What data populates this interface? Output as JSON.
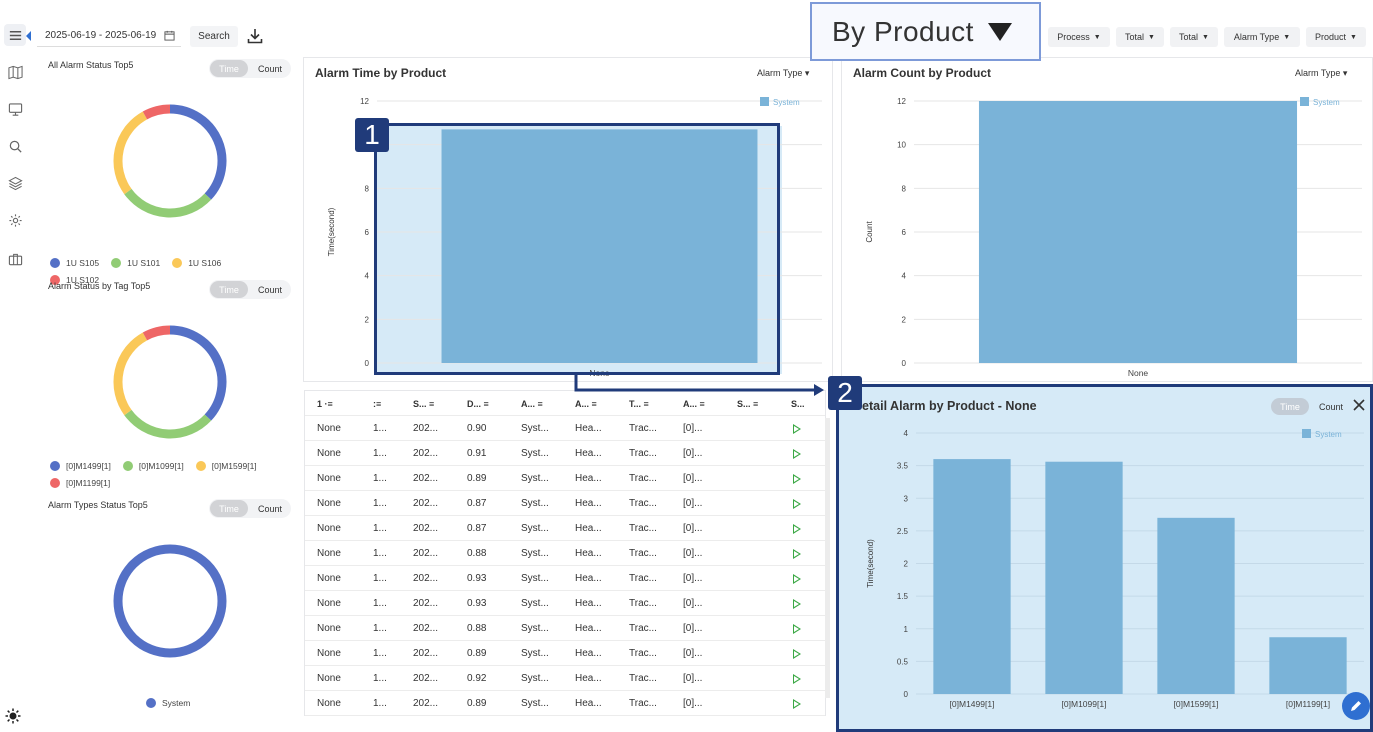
{
  "toolbar": {
    "date_range": "2025-06-19 - 2025-06-19",
    "search_label": "Search",
    "view_selector": "By Product",
    "filters": [
      "Process",
      "Total",
      "Total",
      "Alarm Type",
      "Product"
    ]
  },
  "rail": {
    "icons": [
      "menu-icon",
      "map-icon",
      "monitor-icon",
      "search-icon",
      "layers-icon",
      "gear-icon",
      "briefcase-icon"
    ],
    "theme_icon": "sun-icon"
  },
  "side": {
    "toggle_time": "Time",
    "toggle_count": "Count",
    "panels": [
      {
        "title": "All Alarm Status Top5",
        "slices": [
          {
            "label": "1U S105",
            "value": 37,
            "color": "#5470c6"
          },
          {
            "label": "1U S101",
            "value": 28,
            "color": "#91cc75"
          },
          {
            "label": "1U S106",
            "value": 27,
            "color": "#fac858"
          },
          {
            "label": "1U S102",
            "value": 8,
            "color": "#ee6666"
          }
        ]
      },
      {
        "title": "Alarm Status by Tag Top5",
        "slices": [
          {
            "label": "[0]M1499[1]",
            "value": 37,
            "color": "#5470c6"
          },
          {
            "label": "[0]M1099[1]",
            "value": 28,
            "color": "#91cc75"
          },
          {
            "label": "[0]M1599[1]",
            "value": 27,
            "color": "#fac858"
          },
          {
            "label": "[0]M1199[1]",
            "value": 8,
            "color": "#ee6666"
          }
        ]
      },
      {
        "title": "Alarm Types Status Top5",
        "slices": [
          {
            "label": "System",
            "value": 100,
            "color": "#5470c6"
          }
        ]
      }
    ]
  },
  "chart_data": [
    {
      "type": "bar",
      "title": "Alarm Time by Product",
      "selector": "Alarm Type",
      "categories": [
        "None"
      ],
      "series": [
        {
          "name": "System",
          "values": [
            10.7
          ]
        }
      ],
      "ylabel": "Time(second)",
      "ylim": [
        0,
        12
      ],
      "yticks": [
        0,
        2,
        4,
        6,
        8,
        10,
        12
      ],
      "yticks_shown": [
        "0",
        "2",
        "4",
        "6",
        "8",
        "12"
      ],
      "grid": true,
      "legend": "top-right"
    },
    {
      "type": "bar",
      "title": "Alarm Count by Product",
      "selector": "Alarm Type",
      "categories": [
        "None"
      ],
      "series": [
        {
          "name": "System",
          "values": [
            12
          ]
        }
      ],
      "ylabel": "Count",
      "ylim": [
        0,
        12
      ],
      "yticks": [
        0,
        2,
        4,
        6,
        8,
        10,
        12
      ],
      "grid": true,
      "legend": "top-right"
    },
    {
      "type": "bar",
      "title": "Detail Alarm by Product - None",
      "categories": [
        "[0]M1499[1]",
        "[0]M1099[1]",
        "[0]M1599[1]",
        "[0]M1199[1]"
      ],
      "series": [
        {
          "name": "System",
          "values": [
            3.6,
            3.56,
            2.7,
            0.87
          ]
        }
      ],
      "ylabel": "Time(second)",
      "ylim": [
        0,
        4
      ],
      "yticks": [
        0,
        0.5,
        1,
        1.5,
        2,
        2.5,
        3,
        3.5,
        4
      ],
      "grid": true,
      "legend": "top-right"
    }
  ],
  "detail": {
    "title": "Detail Alarm by Product - None",
    "toggle_time": "Time",
    "toggle_count": "Count"
  },
  "table": {
    "headers": [
      "1 ·≡",
      ":≡",
      "S... ≡",
      "D... ≡",
      "A... ≡",
      "A... ≡",
      "T... ≡",
      "A... ≡",
      "S... ≡",
      "S..."
    ],
    "rows": [
      [
        "None",
        "1...",
        "202...",
        "0.90",
        "Syst...",
        "Hea...",
        "Trac...",
        "[0]..."
      ],
      [
        "None",
        "1...",
        "202...",
        "0.91",
        "Syst...",
        "Hea...",
        "Trac...",
        "[0]..."
      ],
      [
        "None",
        "1...",
        "202...",
        "0.89",
        "Syst...",
        "Hea...",
        "Trac...",
        "[0]..."
      ],
      [
        "None",
        "1...",
        "202...",
        "0.87",
        "Syst...",
        "Hea...",
        "Trac...",
        "[0]..."
      ],
      [
        "None",
        "1...",
        "202...",
        "0.87",
        "Syst...",
        "Hea...",
        "Trac...",
        "[0]..."
      ],
      [
        "None",
        "1...",
        "202...",
        "0.88",
        "Syst...",
        "Hea...",
        "Trac...",
        "[0]..."
      ],
      [
        "None",
        "1...",
        "202...",
        "0.93",
        "Syst...",
        "Hea...",
        "Trac...",
        "[0]..."
      ],
      [
        "None",
        "1...",
        "202...",
        "0.93",
        "Syst...",
        "Hea...",
        "Trac...",
        "[0]..."
      ],
      [
        "None",
        "1...",
        "202...",
        "0.88",
        "Syst...",
        "Hea...",
        "Trac...",
        "[0]..."
      ],
      [
        "None",
        "1...",
        "202...",
        "0.89",
        "Syst...",
        "Hea...",
        "Trac...",
        "[0]..."
      ],
      [
        "None",
        "1...",
        "202...",
        "0.92",
        "Syst...",
        "Hea...",
        "Trac...",
        "[0]..."
      ],
      [
        "None",
        "1...",
        "202...",
        "0.89",
        "Syst...",
        "Hea...",
        "Trac...",
        "[0]..."
      ]
    ]
  },
  "annotations": {
    "badge1": "1",
    "badge2": "2"
  },
  "colors": {
    "bar": "#7ab3d8",
    "highlight": "#d6eaf7",
    "annotation": "#203b7a",
    "play": "#3aa844"
  }
}
